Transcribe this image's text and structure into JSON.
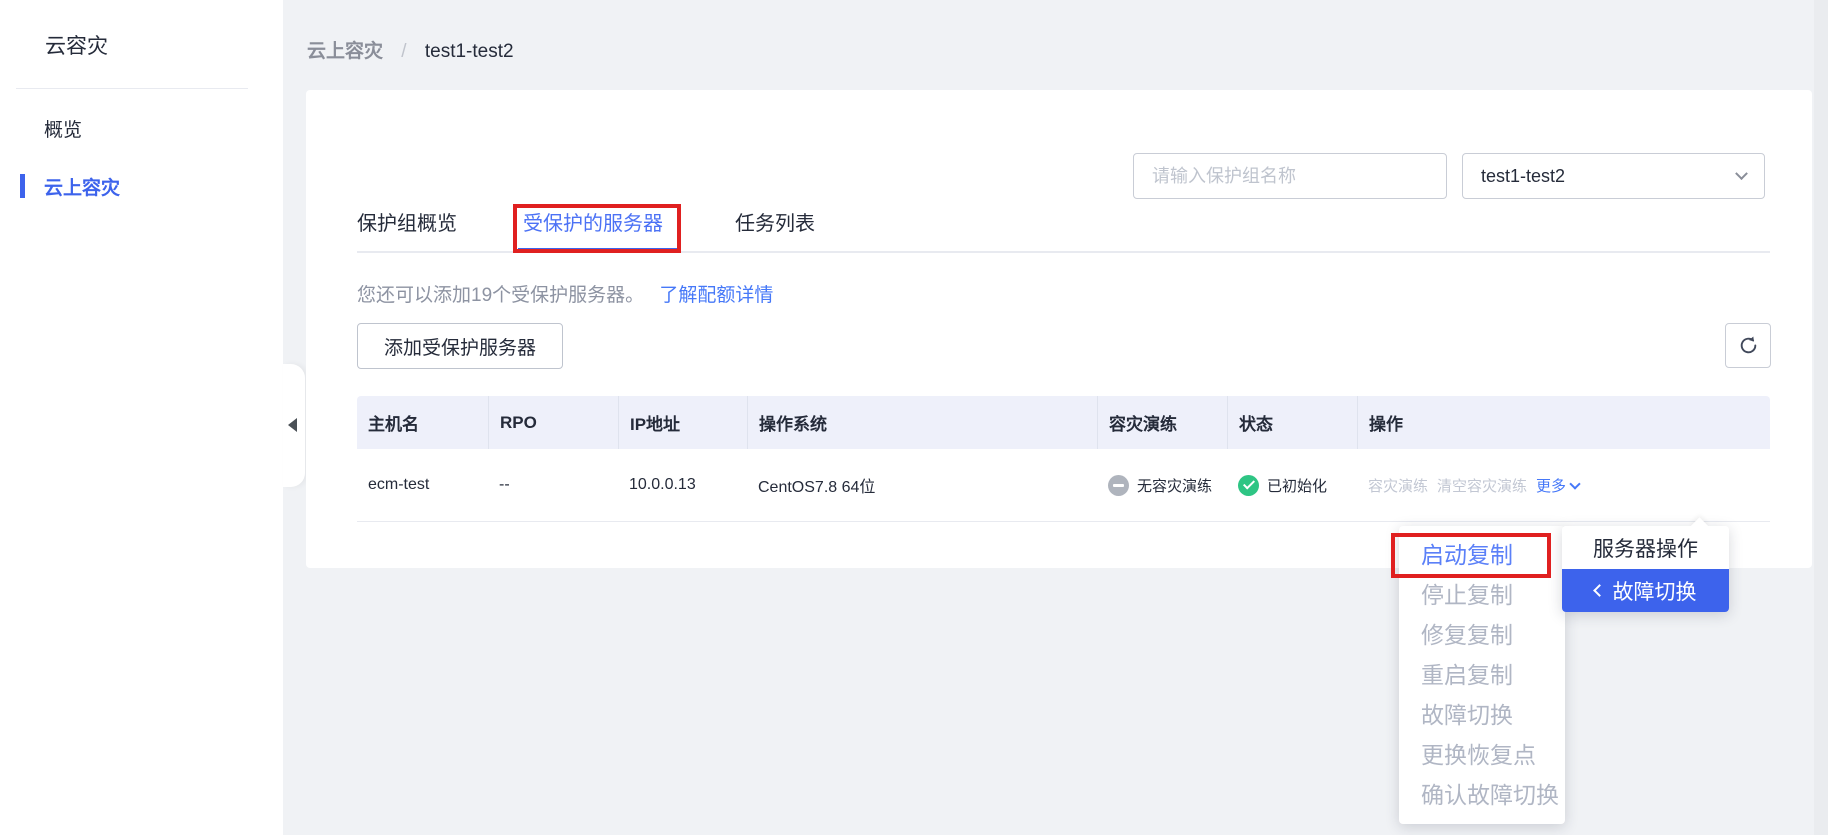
{
  "sidebar": {
    "title": "云容灾",
    "items": [
      {
        "label": "概览"
      },
      {
        "label": "云上容灾"
      }
    ]
  },
  "breadcrumb": {
    "parent": "云上容灾",
    "separator": "/",
    "current": "test1-test2"
  },
  "toolbar": {
    "search_placeholder": "请输入保护组名称",
    "protection_group": "test1-test2"
  },
  "tabs": [
    {
      "label": "保护组概览"
    },
    {
      "label": "受保护的服务器"
    },
    {
      "label": "任务列表"
    }
  ],
  "quota": {
    "text": "您还可以添加19个受保护服务器。",
    "link_label": "了解配额详情"
  },
  "buttons": {
    "add_protected_server": "添加受保护服务器"
  },
  "table": {
    "columns": [
      "主机名",
      "RPO",
      "IP地址",
      "操作系统",
      "容灾演练",
      "状态",
      "操作"
    ],
    "rows": [
      {
        "hostname": "ecm-test",
        "rpo": "--",
        "ip": "10.0.0.13",
        "os": "CentOS7.8 64位",
        "drill_status": "无容灾演练",
        "status": "已初始化",
        "op_drill": "容灾演练",
        "op_clear_drill": "清空容灾演练",
        "op_more": "更多"
      }
    ]
  },
  "more_menu": {
    "items": [
      {
        "label": "服务器操作"
      },
      {
        "label": "故障切换"
      }
    ]
  },
  "failover_menu": {
    "items": [
      {
        "label": "启动复制"
      },
      {
        "label": "停止复制"
      },
      {
        "label": "修复复制"
      },
      {
        "label": "重启复制"
      },
      {
        "label": "故障切换"
      },
      {
        "label": "更换恢复点"
      },
      {
        "label": "确认故障切换"
      }
    ]
  },
  "annotations": {
    "highlighted_tab": "受保护的服务器",
    "highlighted_menu_item": "启动复制"
  },
  "colors": {
    "accent_blue": "#3D63EC",
    "link_blue": "#4678F8",
    "annotation_red": "#E02020",
    "status_green": "#2EC584",
    "status_gray": "#AFB4BD",
    "table_header_bg": "#EEF0FA"
  }
}
